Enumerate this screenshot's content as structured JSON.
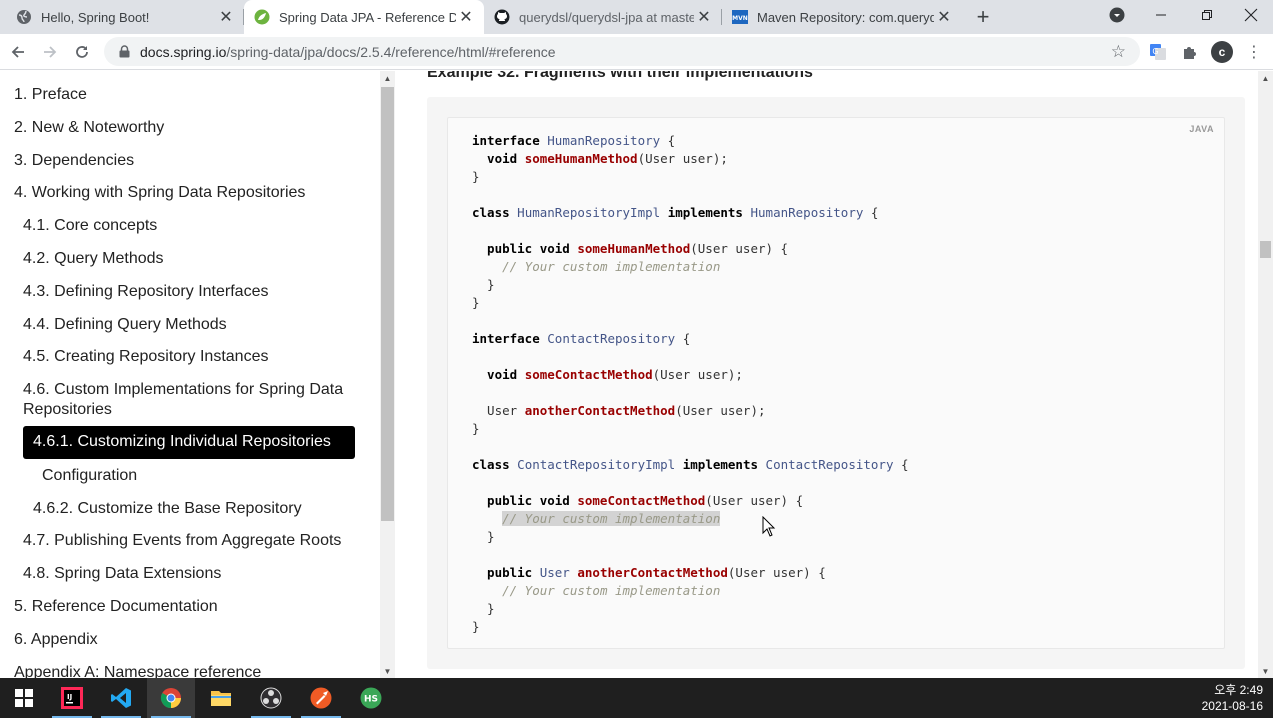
{
  "browser": {
    "tabs": [
      {
        "title": "Hello, Spring Boot!",
        "favicon": "globe-icon"
      },
      {
        "title": "Spring Data JPA - Reference Do",
        "favicon": "spring-leaf-icon"
      },
      {
        "title": "querydsl/querydsl-jpa at master",
        "favicon": "github-icon"
      },
      {
        "title": "Maven Repository: com.querydsl",
        "favicon": "mvn-icon"
      }
    ],
    "url_host": "docs.spring.io",
    "url_path": "/spring-data/jpa/docs/2.5.4/reference/html/#reference",
    "profile_initial": "c"
  },
  "toc": {
    "items": [
      {
        "label": "1. Preface"
      },
      {
        "label": "2. New & Noteworthy"
      },
      {
        "label": "3. Dependencies"
      },
      {
        "label": "4. Working with Spring Data Repositories"
      },
      {
        "label": "4.1. Core concepts"
      },
      {
        "label": "4.2. Query Methods"
      },
      {
        "label": "4.3. Defining Repository Interfaces"
      },
      {
        "label": "4.4. Defining Query Methods"
      },
      {
        "label": "4.5. Creating Repository Instances"
      },
      {
        "label": "4.6. Custom Implementations for Spring Data Repositories"
      },
      {
        "label": "4.6.1. Customizing Individual Repositories"
      },
      {
        "label": "Configuration"
      },
      {
        "label": "4.6.2. Customize the Base Repository"
      },
      {
        "label": "4.7. Publishing Events from Aggregate Roots"
      },
      {
        "label": "4.8. Spring Data Extensions"
      },
      {
        "label": "5. Reference Documentation"
      },
      {
        "label": "6. Appendix"
      },
      {
        "label": "Appendix A: Namespace reference"
      }
    ]
  },
  "main": {
    "example_title": "Example 32. Fragments with their implementations",
    "code_lang": "JAVA",
    "code": {
      "l1_kw": "interface",
      "l1_type": "HumanRepository",
      "l1_rest": " {",
      "l2_kw": "  void ",
      "l2_fn": "someHumanMethod",
      "l2_rest": "(User user);",
      "l3": "}",
      "l4_kw": "class",
      "l4_type": "HumanRepositoryImpl",
      "l4_kw2": "implements",
      "l4_type2": "HumanRepository",
      "l4_rest": " {",
      "l5_kw": "  public void ",
      "l5_fn": "someHumanMethod",
      "l5_rest": "(User user) {",
      "l6_cm": "// Your custom implementation",
      "l7": "  }",
      "l8": "}",
      "l9_kw": "interface",
      "l9_type": "ContactRepository",
      "l9_rest": " {",
      "l10_kw": "  void ",
      "l10_fn": "someContactMethod",
      "l10_rest": "(User user);",
      "l11_pre": "  User ",
      "l11_fn": "anotherContactMethod",
      "l11_rest": "(User user);",
      "l12": "}",
      "l13_kw": "class",
      "l13_type": "ContactRepositoryImpl",
      "l13_kw2": "implements",
      "l13_type2": "ContactRepository",
      "l13_rest": " {",
      "l14_kw": "  public void ",
      "l14_fn": "someContactMethod",
      "l14_rest": "(User user) {",
      "l15_cm": "// Your custom implementation",
      "l16": "  }",
      "l17_kw": "  public ",
      "l17_pre": "User ",
      "l17_fn": "anotherContactMethod",
      "l17_rest": "(User user) {",
      "l18_cm": "// Your custom implementation",
      "l19": "  }",
      "l20": "}"
    }
  },
  "taskbar": {
    "apps": [
      "windows-start-icon",
      "intellij-icon",
      "vscode-icon",
      "chrome-icon",
      "file-explorer-icon",
      "obs-icon",
      "postman-icon",
      "hs-icon"
    ],
    "time": "오후 2:49",
    "date": "2021-08-16"
  }
}
